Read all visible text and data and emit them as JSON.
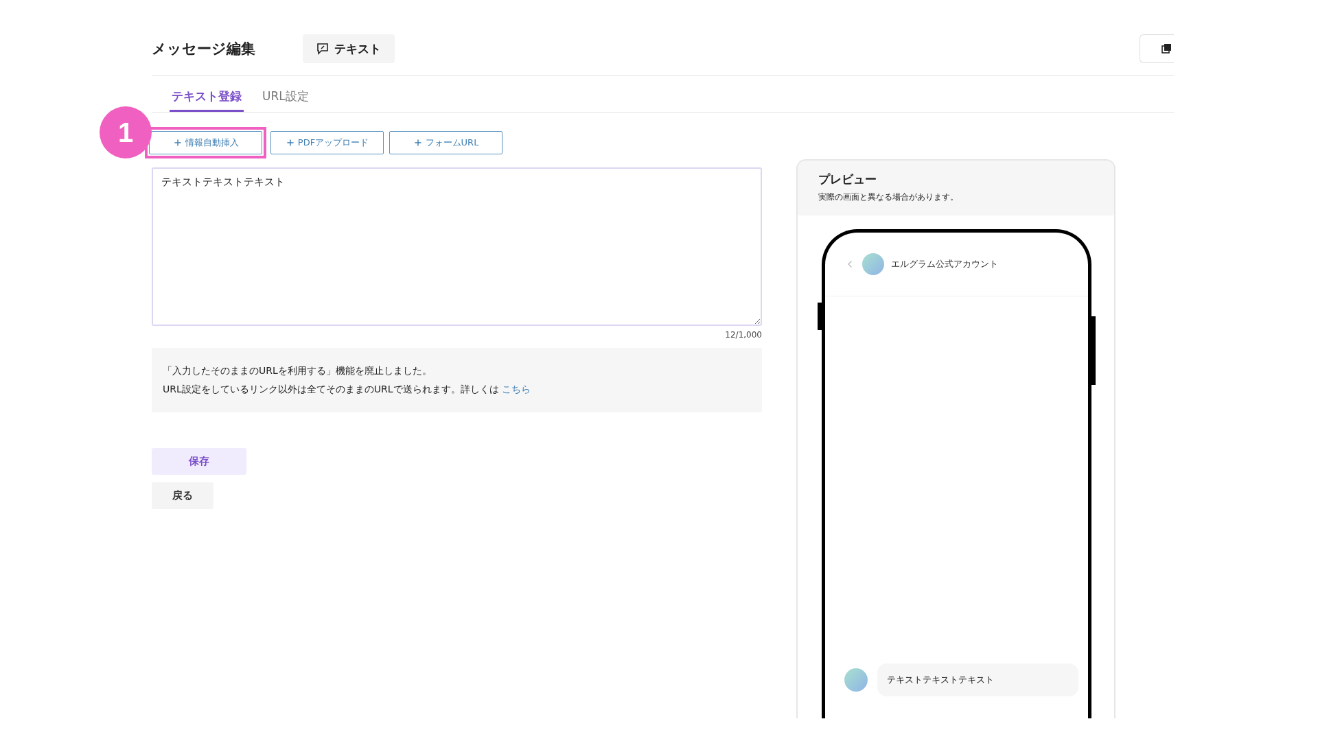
{
  "header": {
    "title": "メッセージ編集",
    "type_chip": "テキスト"
  },
  "tabs": [
    {
      "label": "テキスト登録",
      "selected": true
    },
    {
      "label": "URL設定",
      "selected": false
    }
  ],
  "annotation": {
    "number": "1"
  },
  "insert_buttons": [
    {
      "label": "情報自動挿入",
      "highlighted": true
    },
    {
      "label": "PDFアップロード",
      "highlighted": false
    },
    {
      "label": "フォームURL",
      "highlighted": false
    }
  ],
  "editor": {
    "value": "テキストテキストテキスト",
    "counter": "12/1,000"
  },
  "notice": {
    "lines": [
      "「入力したそのままのURLを利用する」機能を廃止しました。",
      "URL設定をしているリンク以外は全てそのままのURLで送られます。詳しくは"
    ],
    "link": "こちら"
  },
  "actions": [
    {
      "label": "保存",
      "kind": "primary"
    },
    {
      "label": "戻る",
      "kind": "secondary"
    }
  ],
  "preview": {
    "title": "プレビュー",
    "note": "実際の画面と異なる場合があります。",
    "account_name": "エルグラム公式アカウント",
    "messages": [
      "テキストテキストテキスト"
    ]
  }
}
